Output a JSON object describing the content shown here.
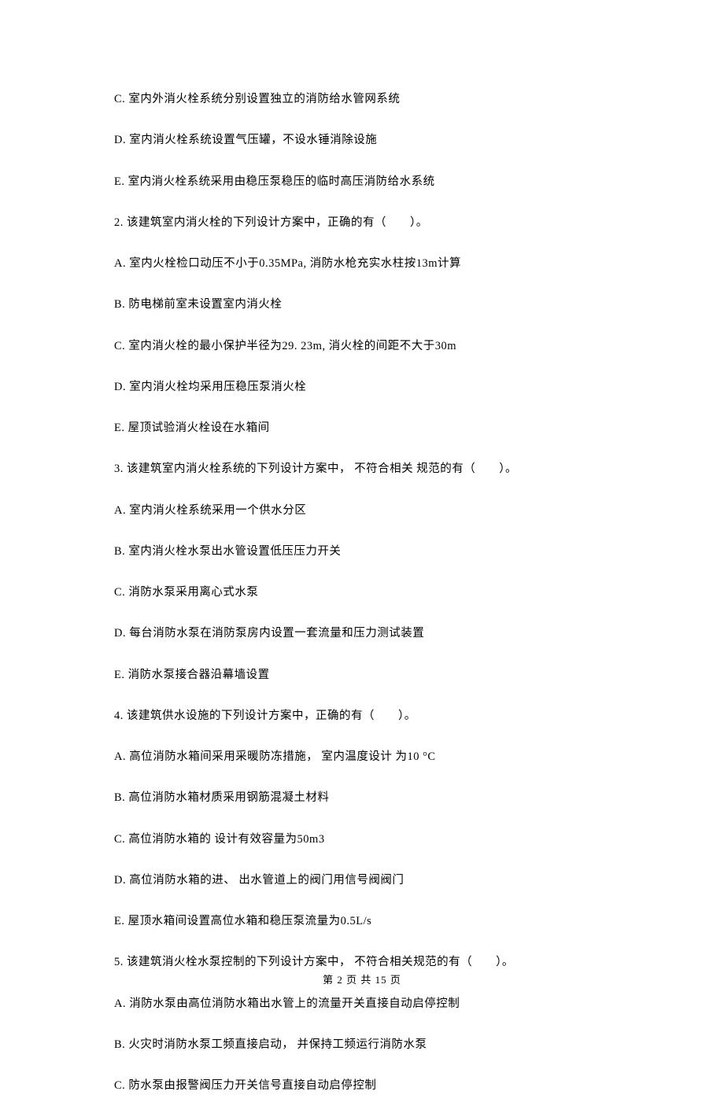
{
  "lines": [
    "C. 室内外消火栓系统分别设置独立的消防给水管网系统",
    "D. 室内消火栓系统设置气压罐，不设水锤消除设施",
    "E. 室内消火栓系统采用由稳压泵稳压的临时高压消防给水系统",
    "2. 该建筑室内消火栓的下列设计方案中，正确的有（　　）。",
    "A. 室内火栓检口动压不小于0.35MPa, 消防水枪充实水柱按13m计算",
    "B. 防电梯前室未设置室内消火栓",
    "C. 室内消火栓的最小保护半径为29. 23m, 消火栓的间距不大于30m",
    "D. 室内消火栓均采用压稳压泵消火栓",
    "E. 屋顶试验消火栓设在水箱间",
    "3. 该建筑室内消火栓系统的下列设计方案中， 不符合相关 规范的有（　　）。",
    "A. 室内消火栓系统采用一个供水分区",
    "B. 室内消火栓水泵出水管设置低压压力开关",
    "C. 消防水泵采用离心式水泵",
    "D. 每台消防水泵在消防泵房内设置一套流量和压力测试装置",
    "E. 消防水泵接合器沿幕墙设置",
    "4. 该建筑供水设施的下列设计方案中，正确的有（　　）。",
    "A. 高位消防水箱间采用采暖防冻措施， 室内温度设计 为10 °C",
    "B. 高位消防水箱材质采用钢筋混凝土材料",
    "C. 高位消防水箱的 设计有效容量为50m3",
    "D. 高位消防水箱的进、 出水管道上的阀门用信号阀阀门",
    "E. 屋顶水箱间设置高位水箱和稳压泵流量为0.5L/s",
    "5. 该建筑消火栓水泵控制的下列设计方案中， 不符合相关规范的有（　　）。",
    "A. 消防水泵由高位消防水箱出水管上的流量开关直接自动启停控制",
    "B. 火灾时消防水泵工频直接启动， 并保持工频运行消防水泵",
    "C. 防水泵由报警阀压力开关信号直接自动启停控制"
  ],
  "footer": "第 2 页 共 15 页"
}
